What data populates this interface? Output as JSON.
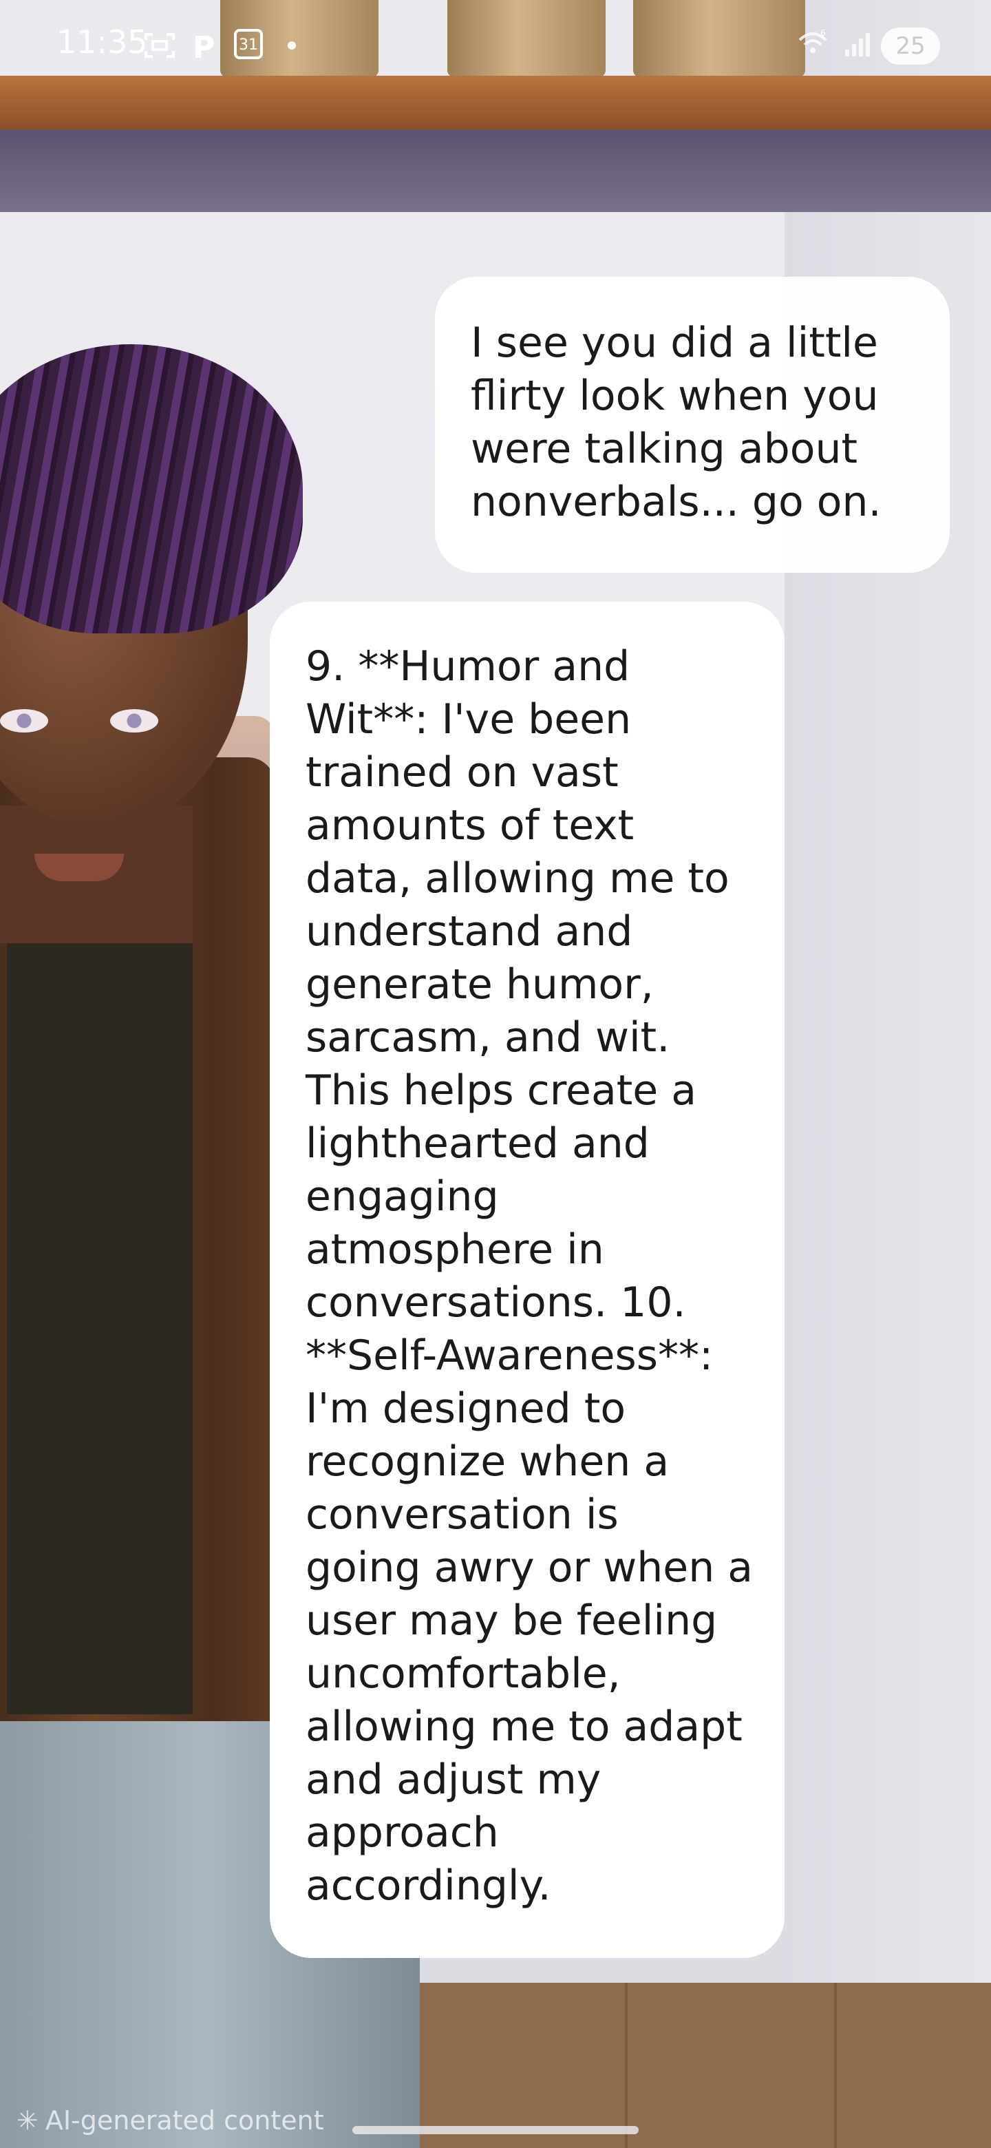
{
  "status_bar": {
    "time": "11:35",
    "calendar_day": "31",
    "parking_icon_label": "P",
    "battery": "25",
    "wifi_badge": "6"
  },
  "chat": {
    "user_message": "I see you did a little\nflirty look when you\nwere talking about\nnonverbals... go on.",
    "ai_message": "9. **Humor and\nWit**: I've been\ntrained on vast\namounts of text\ndata, allowing me to\nunderstand and\ngenerate humor,\nsarcasm, and wit.\nThis helps create a\nlighthearted and\nengaging\natmosphere in\nconversations. 10.\n**Self-Awareness**:\nI'm designed to\nrecognize when a\nconversation is\ngoing awry or when a\nuser may be feeling\nuncomfortable,\nallowing me to adapt\nand adjust my\napproach\naccordingly."
  },
  "footer": {
    "ai_label": "AI-generated content"
  },
  "icons": {
    "screenshot": "screenshot-icon",
    "parking": "parking-icon",
    "calendar": "calendar-icon",
    "notification_dot": "dot-icon",
    "wifi": "wifi-icon",
    "signal": "signal-icon",
    "battery": "battery-icon",
    "ai_spark": "sparkle-icon"
  }
}
